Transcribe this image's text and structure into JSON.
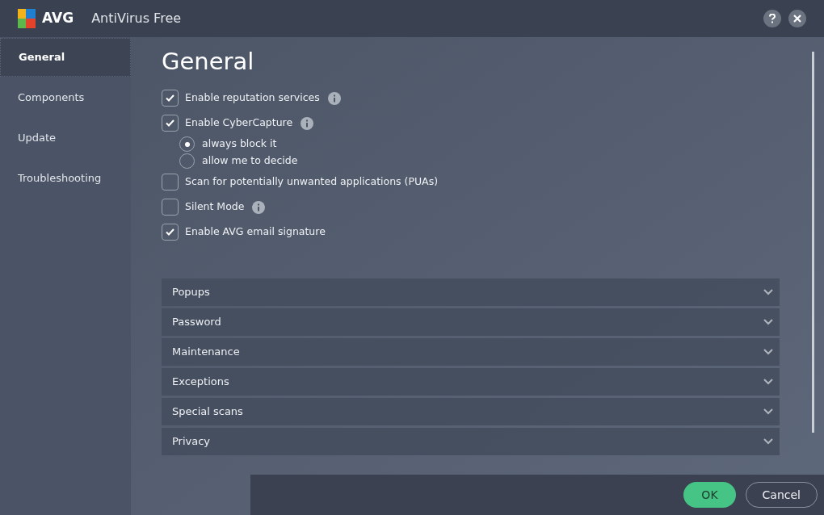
{
  "window": {
    "brand": "AVG",
    "title": "AntiVirus Free"
  },
  "sidebar": {
    "items": [
      {
        "label": "General",
        "selected": true
      },
      {
        "label": "Components",
        "selected": false
      },
      {
        "label": "Update",
        "selected": false
      },
      {
        "label": "Troubleshooting",
        "selected": false
      }
    ]
  },
  "heading": "General",
  "options": [
    {
      "label": "Enable reputation services",
      "checked": true,
      "info": true
    },
    {
      "label": "Enable CyberCapture",
      "checked": true,
      "info": true,
      "choices": [
        {
          "label": "always block it",
          "selected": true
        },
        {
          "label": "allow me to decide",
          "selected": false
        }
      ]
    },
    {
      "label": "Scan for potentially unwanted applications (PUAs)",
      "checked": false,
      "info": false
    },
    {
      "label": "Silent Mode",
      "checked": false,
      "info": true
    },
    {
      "label": "Enable AVG email signature",
      "checked": true,
      "info": false
    }
  ],
  "sections": [
    {
      "label": "Popups",
      "expanded": false
    },
    {
      "label": "Password",
      "expanded": false
    },
    {
      "label": "Maintenance",
      "expanded": false
    },
    {
      "label": "Exceptions",
      "expanded": false
    },
    {
      "label": "Special scans",
      "expanded": false
    },
    {
      "label": "Privacy",
      "expanded": false
    }
  ],
  "buttons": [
    {
      "label": "OK",
      "kind": "primary"
    },
    {
      "label": "Cancel",
      "kind": "secondary"
    }
  ]
}
